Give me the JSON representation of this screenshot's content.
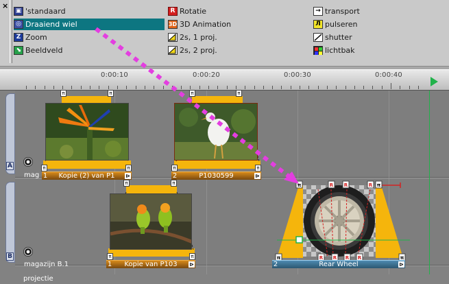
{
  "palette": {
    "close_glyph": "×",
    "effects": [
      {
        "label": "'standaard",
        "icon": "standard-effect-icon"
      },
      {
        "label": "Draaiend wiel",
        "icon": "rotating-wheel-icon"
      },
      {
        "label": "Zoom",
        "icon": "zoom-icon"
      },
      {
        "label": "Beeldveld",
        "icon": "image-field-icon"
      },
      {
        "label": "Rotatie",
        "icon": "rotation-icon"
      },
      {
        "label": "3D Animation",
        "icon": "3d-animation-icon"
      },
      {
        "label": "2s, 1 proj.",
        "icon": "one-projector-icon"
      },
      {
        "label": "2s, 2 proj.",
        "icon": "two-projector-icon"
      },
      {
        "label": "transport",
        "icon": "transport-arrow-icon"
      },
      {
        "label": "pulseren",
        "icon": "pulse-icon"
      },
      {
        "label": "shutter",
        "icon": "shutter-icon"
      },
      {
        "label": "lichtbak",
        "icon": "lightbox-icon"
      }
    ],
    "selected": "Draaiend wiel",
    "icon_glyphs": {
      "zoom": "Z",
      "rotation": "R",
      "anim": "3D",
      "transport": "→",
      "pulse": "Л"
    }
  },
  "ruler": {
    "labels": [
      "0:00:10",
      "0:00:20",
      "0:00:30",
      "0:00:40"
    ]
  },
  "tracks": [
    {
      "letter": "A",
      "name": "mag 1",
      "clips": [
        {
          "number": "1",
          "name": "Kopie (2) van P1",
          "end_glyph": "⊳",
          "image": "bird-of-paradise-flower"
        },
        {
          "number": "2",
          "name": "P1030599",
          "end_glyph": "⊳",
          "image": "white-ibis-bird"
        }
      ]
    },
    {
      "letter": "B",
      "name": "magazijn B.1",
      "clips": [
        {
          "number": "1",
          "name": "Kopie van P103",
          "end_glyph": "⊳",
          "image": "lovebird-parrots"
        },
        {
          "number": "2",
          "name": "Rear Wheel",
          "end_glyph": "⊳",
          "image": "rear-wheel"
        }
      ]
    }
  ],
  "projection_label": "projectie",
  "colors": {
    "drag_arrow": "#e33ee0",
    "keyframe_yellow": "#f5b50c",
    "selection": "#0d7681",
    "cursor_green": "#21b24a"
  }
}
